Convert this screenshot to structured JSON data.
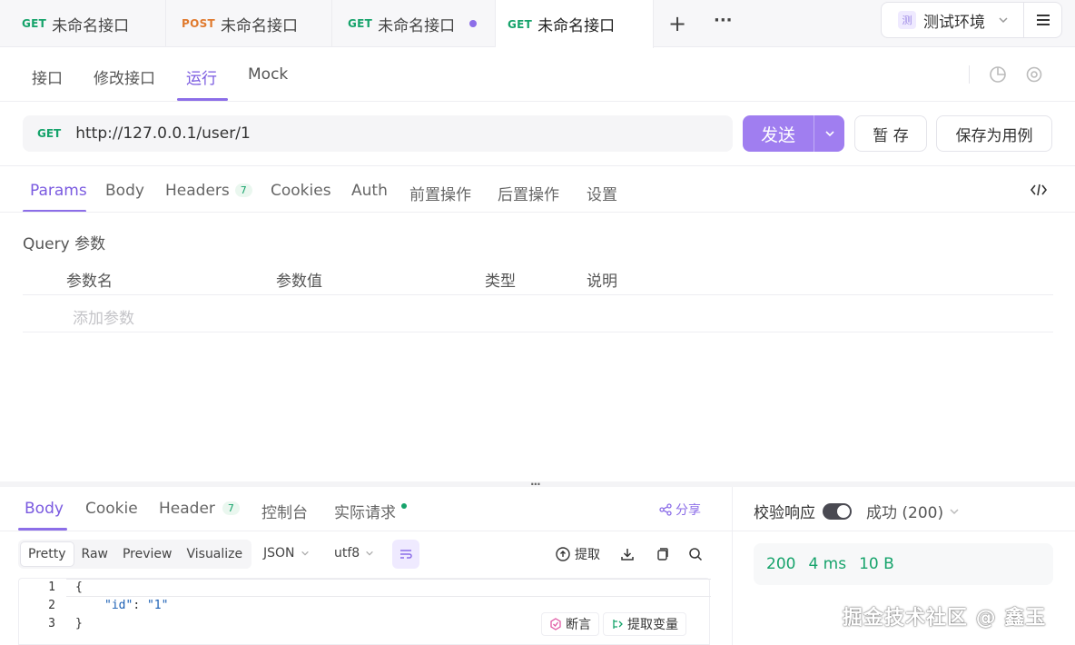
{
  "request_tabs": [
    {
      "method": "GET",
      "title": "未命名接口"
    },
    {
      "method": "POST",
      "title": "未命名接口"
    },
    {
      "method": "GET",
      "title": "未命名接口"
    },
    {
      "method": "GET",
      "title": "未命名接口"
    }
  ],
  "new_tab_label": "+",
  "more_label": "···",
  "environment": {
    "badge": "测",
    "name": "测试环境"
  },
  "sub_tabs": [
    "接口",
    "修改接口",
    "运行",
    "Mock"
  ],
  "url_bar": {
    "method": "GET",
    "url": "http://127.0.0.1/user/1"
  },
  "actions": {
    "send": "发送",
    "save_temp": "暂 存",
    "save_as_case": "保存为用例"
  },
  "param_tabs": {
    "params": "Params",
    "body": "Body",
    "headers": "Headers",
    "headers_count": "7",
    "cookies": "Cookies",
    "auth": "Auth",
    "pre": "前置操作",
    "post": "后置操作",
    "settings": "设置"
  },
  "query": {
    "title": "Query 参数",
    "columns": [
      "参数名",
      "参数值",
      "类型",
      "说明"
    ],
    "add_placeholder": "添加参数"
  },
  "response": {
    "tabs": {
      "body": "Body",
      "cookie": "Cookie",
      "header": "Header",
      "header_count": "7",
      "console": "控制台",
      "actual": "实际请求"
    },
    "share": "分享",
    "formats": [
      "Pretty",
      "Raw",
      "Preview",
      "Visualize"
    ],
    "lang": "JSON",
    "encoding": "utf8",
    "extract": "提取",
    "code_lines": [
      {
        "n": "1",
        "text": "{"
      },
      {
        "n": "2",
        "key": "\"id\"",
        "sep": ": ",
        "value": "\"1\""
      },
      {
        "n": "3",
        "text": "}"
      }
    ],
    "assert": "断言",
    "extract_var": "提取变量",
    "validate_label": "校验响应",
    "status_label": "成功 (200)",
    "stats": {
      "code": "200",
      "time": "4 ms",
      "size": "10 B"
    }
  },
  "watermark": "掘金技术社区 @ 鑫玉",
  "colors": {
    "accent": "#8c6ee8",
    "get": "#16a36b",
    "post": "#e07a2e"
  }
}
